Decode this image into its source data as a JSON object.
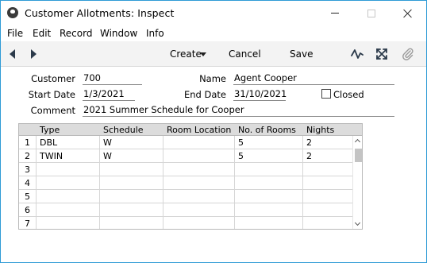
{
  "window": {
    "title": "Customer Allotments: Inspect"
  },
  "menu": {
    "items": [
      "File",
      "Edit",
      "Record",
      "Window",
      "Info"
    ]
  },
  "toolbar": {
    "create_label": "Create",
    "cancel_label": "Cancel",
    "save_label": "Save",
    "icons": [
      "back-arrow-icon",
      "forward-arrow-icon",
      "activity-icon",
      "expand-icon",
      "paperclip-icon"
    ]
  },
  "form": {
    "customer_label": "Customer",
    "customer_value": "700",
    "name_label": "Name",
    "name_value": "Agent Cooper",
    "start_date_label": "Start Date",
    "start_date_value": "1/3/2021",
    "end_date_label": "End Date",
    "end_date_value": "31/10/2021",
    "closed_label": "Closed",
    "closed_checked": false,
    "comment_label": "Comment",
    "comment_value": "2021 Summer Schedule for Cooper"
  },
  "grid": {
    "columns": [
      "Type",
      "Schedule",
      "Room Location",
      "No. of Rooms",
      "Nights"
    ],
    "rows": [
      {
        "num": "1",
        "type": "DBL",
        "schedule": "W",
        "room_location": "",
        "rooms": "5",
        "nights": "2"
      },
      {
        "num": "2",
        "type": "TWIN",
        "schedule": "W",
        "room_location": "",
        "rooms": "5",
        "nights": "2"
      },
      {
        "num": "3",
        "type": "",
        "schedule": "",
        "room_location": "",
        "rooms": "",
        "nights": ""
      },
      {
        "num": "4",
        "type": "",
        "schedule": "",
        "room_location": "",
        "rooms": "",
        "nights": ""
      },
      {
        "num": "5",
        "type": "",
        "schedule": "",
        "room_location": "",
        "rooms": "",
        "nights": ""
      },
      {
        "num": "6",
        "type": "",
        "schedule": "",
        "room_location": "",
        "rooms": "",
        "nights": ""
      },
      {
        "num": "7",
        "type": "",
        "schedule": "",
        "room_location": "",
        "rooms": "",
        "nights": ""
      }
    ]
  },
  "colors": {
    "window_border": "#2f9bd6",
    "toolbar_bg": "#f3f3f3",
    "grid_header_bg": "#dcdcdc",
    "nav_arrow": "#2b3a4a"
  }
}
